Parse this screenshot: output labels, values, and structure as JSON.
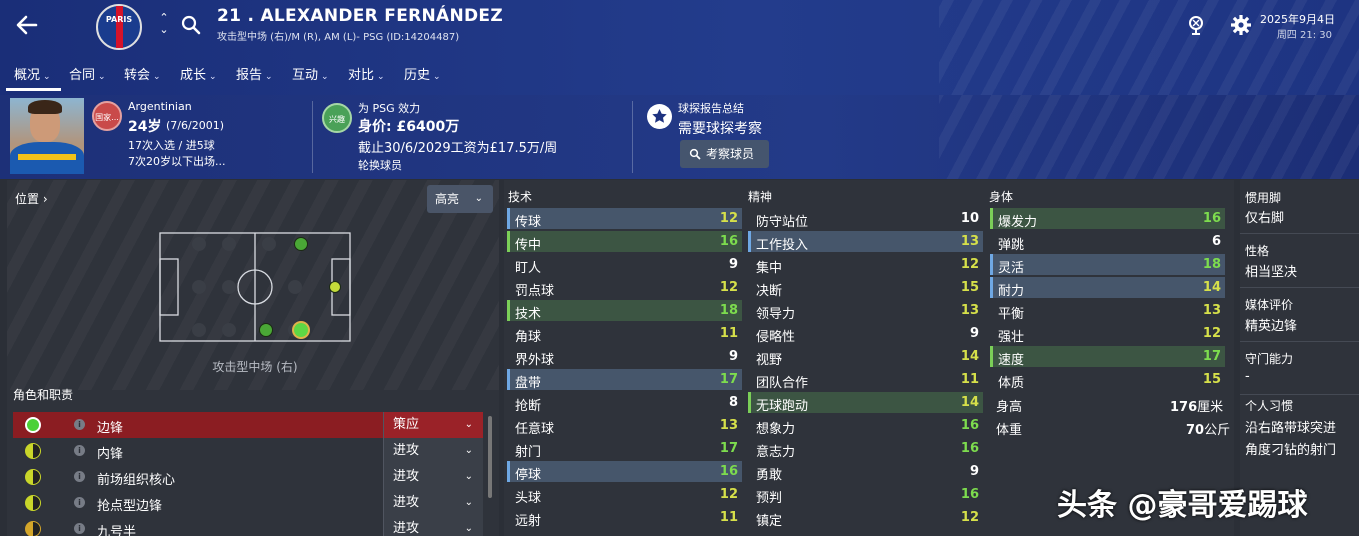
{
  "header": {
    "club_crest_text": "PARIS",
    "player_title": "21 . ALEXANDER FERNÁNDEZ",
    "player_subtitle": "攻击型中场 (右)/M (R), AM (L)- PSG (ID:14204487)",
    "date": "2025年9月4日",
    "time": "周四 21: 30"
  },
  "nav": {
    "items": [
      {
        "label": "概况",
        "active": true
      },
      {
        "label": "合同"
      },
      {
        "label": "转会"
      },
      {
        "label": "成长"
      },
      {
        "label": "报告"
      },
      {
        "label": "互动"
      },
      {
        "label": "对比"
      },
      {
        "label": "历史"
      }
    ]
  },
  "info": {
    "nat_badge": "国家...",
    "nationality": "Argentinian",
    "age": "24岁",
    "dob": "(7/6/2001)",
    "caps": "17次入选 / 进5球",
    "u20": "7次20岁以下出场...",
    "interest_badge": "兴趣",
    "plays_for": "为 PSG 效力",
    "value_label": "身价: ",
    "value": "£6400万",
    "contract": "截止30/6/2029工资为£17.5万/周",
    "squad_status": "轮换球员",
    "scout_title": "球探报告总结",
    "scout_need": "需要球探考察",
    "scout_button": "考察球员"
  },
  "left": {
    "position_label": "位置 ›",
    "highlight": "高亮",
    "pitch_label": "攻击型中场 (右)",
    "roles_header": "角色和职责",
    "roles": [
      {
        "name": "边锋",
        "duty": "策应",
        "selected": true,
        "color": "#4cd137"
      },
      {
        "name": "内锋",
        "duty": "进攻",
        "color": "#c9d62a"
      },
      {
        "name": "前场组织核心",
        "duty": "进攻",
        "color": "#c9d62a"
      },
      {
        "name": "抢点型边锋",
        "duty": "进攻",
        "color": "#c9d62a"
      },
      {
        "name": "九号半",
        "duty": "进攻",
        "color": "#d4a62a"
      }
    ]
  },
  "attributes": {
    "technical_header": "技术",
    "mental_header": "精神",
    "physical_header": "身体",
    "technical": [
      {
        "name": "传球",
        "value": "12",
        "hl": "b"
      },
      {
        "name": "传中",
        "value": "16",
        "hl": "g"
      },
      {
        "name": "盯人",
        "value": "9"
      },
      {
        "name": "罚点球",
        "value": "12"
      },
      {
        "name": "技术",
        "value": "18",
        "hl": "g"
      },
      {
        "name": "角球",
        "value": "11"
      },
      {
        "name": "界外球",
        "value": "9"
      },
      {
        "name": "盘带",
        "value": "17",
        "hl": "b"
      },
      {
        "name": "抢断",
        "value": "8"
      },
      {
        "name": "任意球",
        "value": "13"
      },
      {
        "name": "射门",
        "value": "17"
      },
      {
        "name": "停球",
        "value": "16",
        "hl": "b"
      },
      {
        "name": "头球",
        "value": "12"
      },
      {
        "name": "远射",
        "value": "11"
      }
    ],
    "mental": [
      {
        "name": "防守站位",
        "value": "10"
      },
      {
        "name": "工作投入",
        "value": "13",
        "hl": "b"
      },
      {
        "name": "集中",
        "value": "12"
      },
      {
        "name": "决断",
        "value": "15"
      },
      {
        "name": "领导力",
        "value": "13"
      },
      {
        "name": "侵略性",
        "value": "9"
      },
      {
        "name": "视野",
        "value": "14"
      },
      {
        "name": "团队合作",
        "value": "11"
      },
      {
        "name": "无球跑动",
        "value": "14",
        "hl": "g"
      },
      {
        "name": "想象力",
        "value": "16"
      },
      {
        "name": "意志力",
        "value": "16"
      },
      {
        "name": "勇敢",
        "value": "9"
      },
      {
        "name": "预判",
        "value": "16"
      },
      {
        "name": "镇定",
        "value": "12"
      }
    ],
    "physical": [
      {
        "name": "爆发力",
        "value": "16",
        "hl": "g"
      },
      {
        "name": "弹跳",
        "value": "6"
      },
      {
        "name": "灵活",
        "value": "18",
        "hl": "b"
      },
      {
        "name": "耐力",
        "value": "14",
        "hl": "b"
      },
      {
        "name": "平衡",
        "value": "13"
      },
      {
        "name": "强壮",
        "value": "12"
      },
      {
        "name": "速度",
        "value": "17",
        "hl": "g"
      },
      {
        "name": "体质",
        "value": "15"
      }
    ],
    "height_label": "身高",
    "height_value": "176",
    "height_unit": "厘米",
    "weight_label": "体重",
    "weight_value": "70",
    "weight_unit": "公斤"
  },
  "side": {
    "foot_label": "惯用脚",
    "foot_value": "仅右脚",
    "personality_label": "性格",
    "personality_value": "相当坚决",
    "media_label": "媒体评价",
    "media_value": "精英边锋",
    "gk_label": "守门能力",
    "gk_value": "-",
    "habits_label": "个人习惯",
    "habit1": "沿右路带球突进",
    "habit2": "角度刁钻的射门"
  },
  "watermark": "头条 @豪哥爱踢球",
  "colors": {
    "high": "#7ddc4e",
    "mid": "#d6e04a",
    "low": "#ffffff"
  }
}
